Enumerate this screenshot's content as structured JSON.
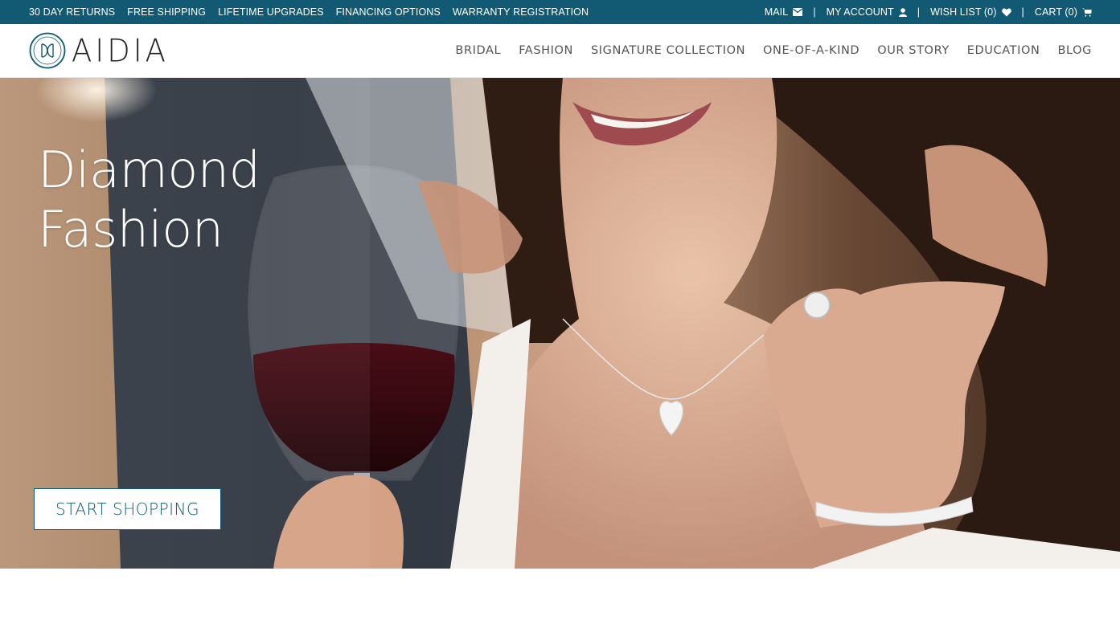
{
  "topbar": {
    "links": [
      "30 DAY RETURNS",
      "FREE SHIPPING",
      "LIFETIME UPGRADES",
      "FINANCING OPTIONS",
      "WARRANTY REGISTRATION"
    ],
    "mail": "MAIL",
    "account": "MY ACCOUNT",
    "wishlist": "WISH LIST (0)",
    "cart": "CART (0)",
    "separator": "|"
  },
  "brand": {
    "name": "AIDIA",
    "color": "#125a74"
  },
  "nav": [
    "BRIDAL",
    "FASHION",
    "SIGNATURE COLLECTION",
    "ONE-OF-A-KIND",
    "OUR STORY",
    "EDUCATION",
    "BLOG"
  ],
  "hero": {
    "title_line1": "Diamond",
    "title_line2": "Fashion",
    "cta": "START SHOPPING"
  },
  "icons": {
    "mail": "envelope-icon",
    "account": "user-icon",
    "wishlist": "heart-icon",
    "cart": "cart-icon"
  }
}
